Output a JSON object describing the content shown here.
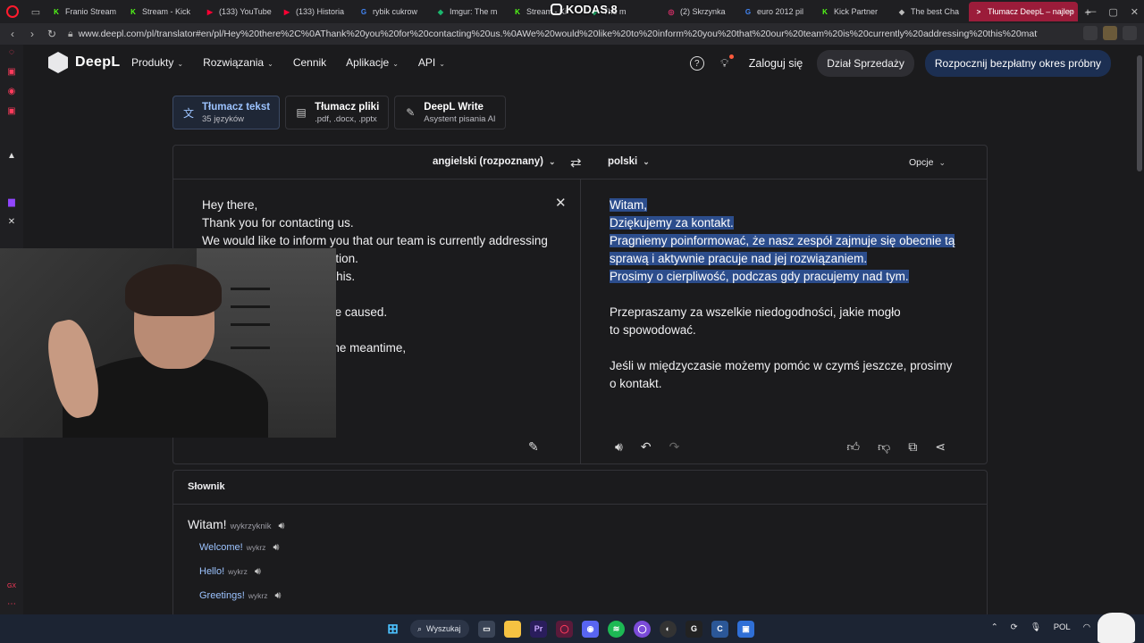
{
  "browser": {
    "tabs": [
      {
        "label": "Franio Stream",
        "fav": "K",
        "color": "#53fc18"
      },
      {
        "label": "Stream - Kick",
        "fav": "K",
        "color": "#53fc18"
      },
      {
        "label": "(133) YouTube",
        "fav": "▶",
        "color": "#ff0033"
      },
      {
        "label": "(133) Historia",
        "fav": "▶",
        "color": "#ff0033"
      },
      {
        "label": "rybik cukrow",
        "fav": "G",
        "color": "#4285f4"
      },
      {
        "label": "Imgur: The m",
        "fav": "◆",
        "color": "#1bb76e"
      },
      {
        "label": "Stream - Ki",
        "fav": "K",
        "color": "#53fc18"
      },
      {
        "label": "The m",
        "fav": "◆",
        "color": "#1bb76e"
      },
      {
        "label": "(2) Skrzynka",
        "fav": "◎",
        "color": "#e1306c"
      },
      {
        "label": "euro 2012 pil",
        "fav": "G",
        "color": "#4285f4"
      },
      {
        "label": "Kick Partner",
        "fav": "K",
        "color": "#53fc18"
      },
      {
        "label": "The best Cha",
        "fav": "◆",
        "color": "#bbbbbb"
      },
      {
        "label": "Tłumacz DeepL – najlep",
        "fav": ">",
        "color": "#ffffff",
        "active": true
      }
    ],
    "url": "www.deepl.com/pl/translator#en/pl/Hey%20there%2C%0AThank%20you%20for%20contacting%20us.%0AWe%20would%20like%20to%20inform%20you%20that%20our%20team%20is%20currently%20addressing%20this%20matter%20and%20actively%2"
  },
  "overlay": {
    "streamer_name": "KODAS.8"
  },
  "header": {
    "brand": "DeepL",
    "nav": [
      "Produkty",
      "Rozwiązania",
      "Cennik",
      "Aplikacje",
      "API"
    ],
    "login": "Zaloguj się",
    "sales_button": "Dział Sprzedaży",
    "trial_button": "Rozpocznij bezpłatny okres próbny"
  },
  "mode_tabs": [
    {
      "title": "Tłumacz tekst",
      "subtitle": "35 języków",
      "icon": "translate-icon"
    },
    {
      "title": "Tłumacz pliki",
      "subtitle": ".pdf, .docx, .pptx",
      "icon": "file-icon"
    },
    {
      "title": "DeepL Write",
      "subtitle": "Asystent pisania AI",
      "icon": "magic-pen-icon"
    }
  ],
  "translator": {
    "source_language": "angielski (rozpoznany)",
    "target_language": "polski",
    "options_label": "Opcje",
    "source_lines": [
      "Hey there,",
      "Thank you for contacting us.",
      "We would like to inform you that our team is currently addressing",
      "working towards a resolution.",
      "tience while we work on this.",
      "",
      "onvenience this may have caused.",
      "",
      "e can assist you with in the meantime,",
      "contact us."
    ],
    "target_lines": [
      {
        "text": "Witam,",
        "highlight": true
      },
      {
        "text": "Dziękujemy za kontakt.",
        "highlight": true
      },
      {
        "text": "Pragniemy poinformować, że nasz zespół zajmuje się obecnie tą",
        "highlight": true
      },
      {
        "text": "sprawą i aktywnie pracuje nad jej rozwiązaniem.",
        "highlight": true
      },
      {
        "text": "Prosimy o cierpliwość, podczas gdy pracujemy nad tym.",
        "highlight": true
      },
      {
        "text": "",
        "highlight": false
      },
      {
        "text": "Przepraszamy za wszelkie niedogodności, jakie mogło",
        "highlight": false
      },
      {
        "text": "to spowodować.",
        "highlight": false
      },
      {
        "text": "",
        "highlight": false
      },
      {
        "text": "Jeśli w międzyczasie możemy pomóc w czymś jeszcze, prosimy",
        "highlight": false
      },
      {
        "text": "o kontakt.",
        "highlight": false
      }
    ]
  },
  "dictionary": {
    "title": "Słownik",
    "main_word": "Witam!",
    "main_pos": "wykrzyknik",
    "entries": [
      {
        "word": "Welcome!",
        "pos": "wykrz"
      },
      {
        "word": "Hello!",
        "pos": "wykrz"
      },
      {
        "word": "Greetings!",
        "pos": "wykrz"
      }
    ]
  },
  "taskbar": {
    "search_label": "Wyszukaj",
    "language": "POL"
  }
}
